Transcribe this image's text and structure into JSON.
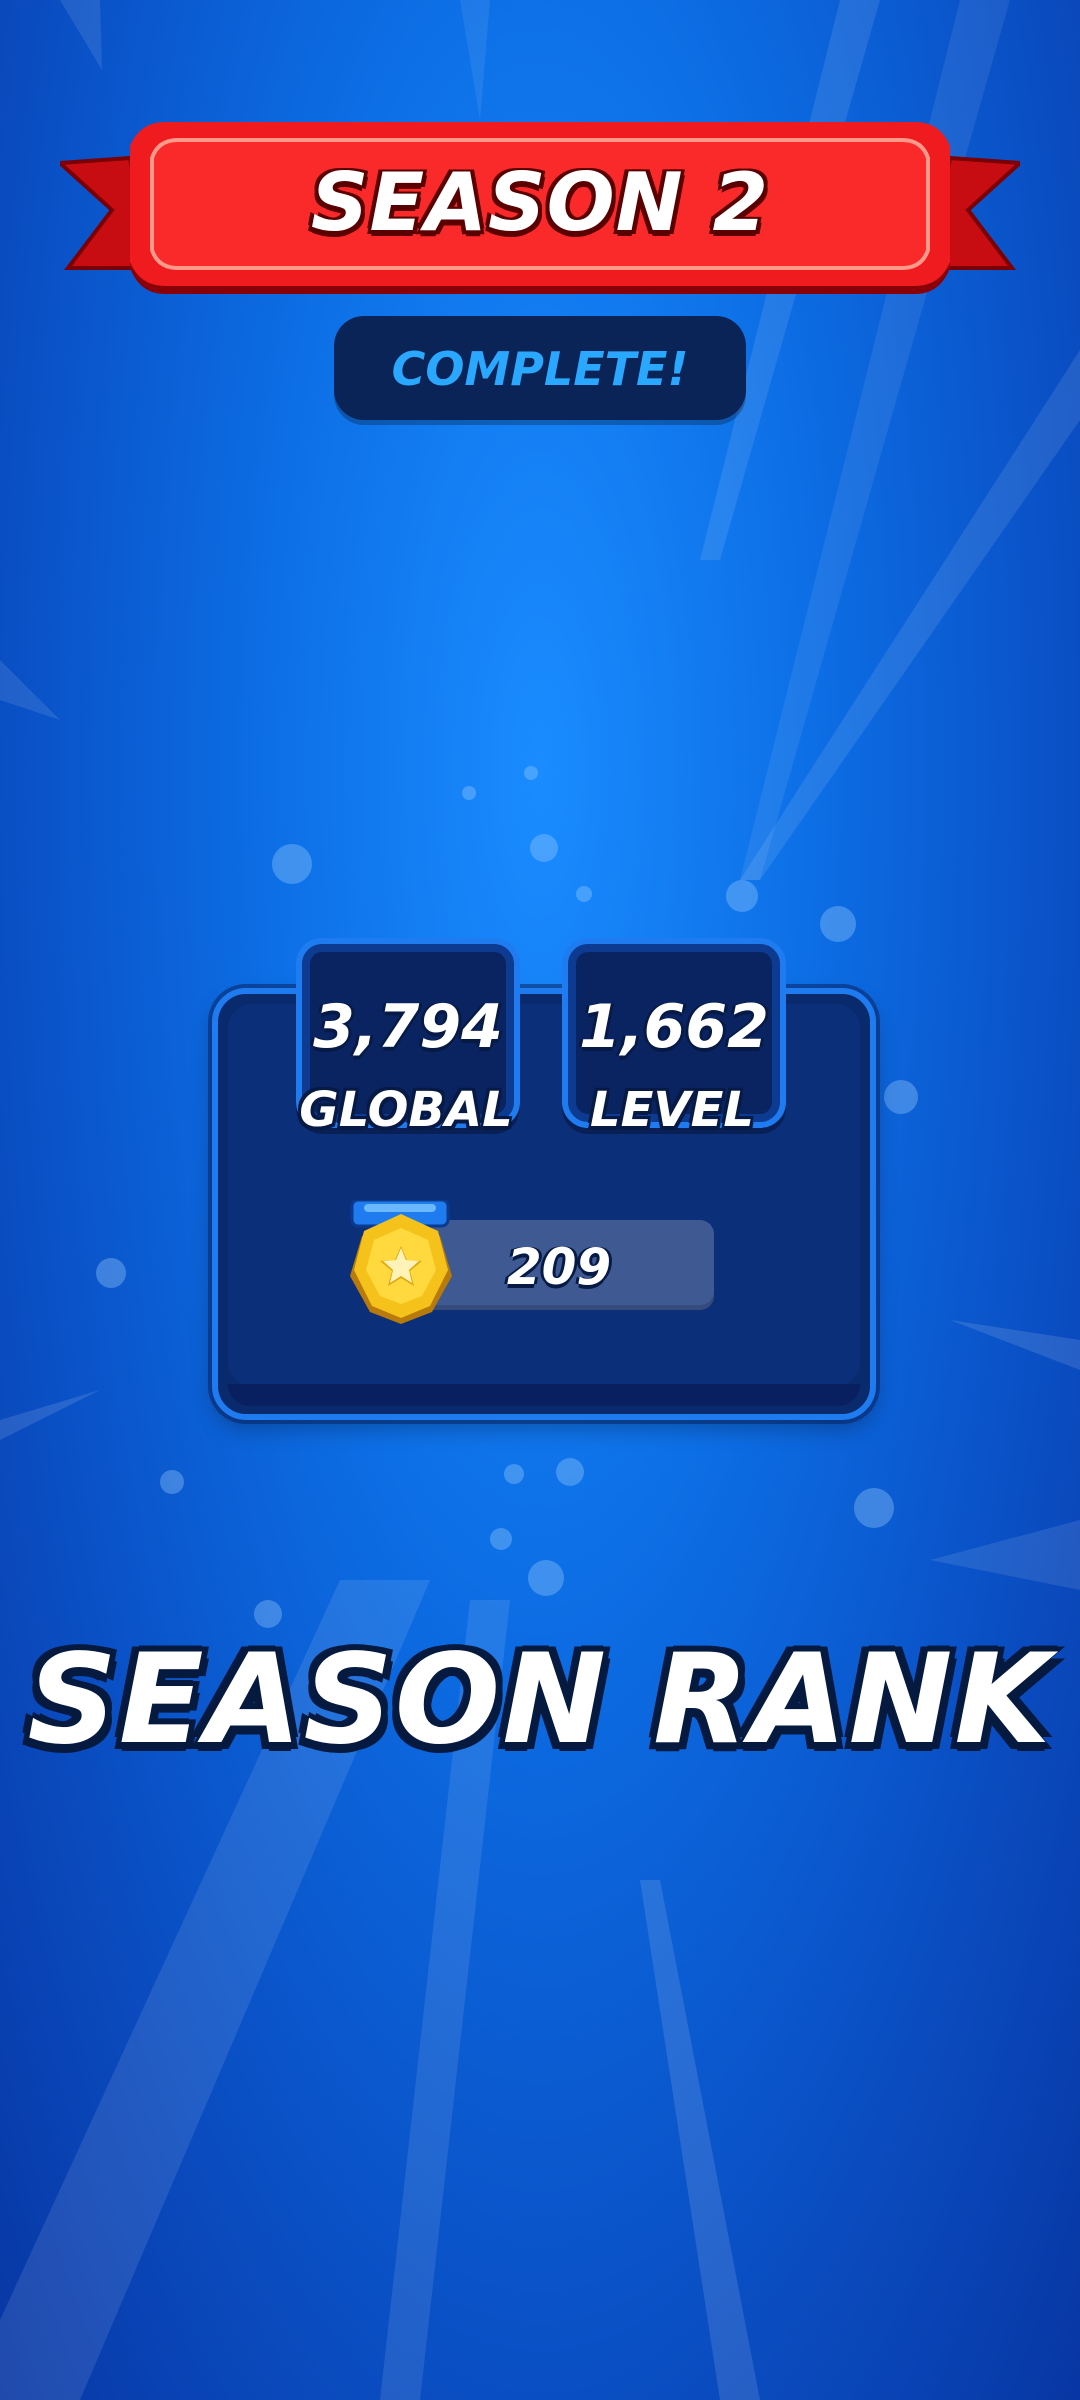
{
  "banner": {
    "title": "SEASON 2",
    "subtitle": "COMPLETE!"
  },
  "rank": {
    "global_value": "3,794",
    "global_label": "GLOBAL",
    "level_value": "1,662",
    "level_label": "LEVEL",
    "points_value": "209"
  },
  "caption": "SEASON RANK",
  "colors": {
    "background": "#0d6fe6",
    "ribbon": "#e8141a",
    "panel": "#0a2a6e",
    "accent": "#1e7cf0",
    "complete_text": "#2aa8ff",
    "medal": "#f5c21b"
  },
  "icons": {
    "medal": "star-medal-icon"
  }
}
